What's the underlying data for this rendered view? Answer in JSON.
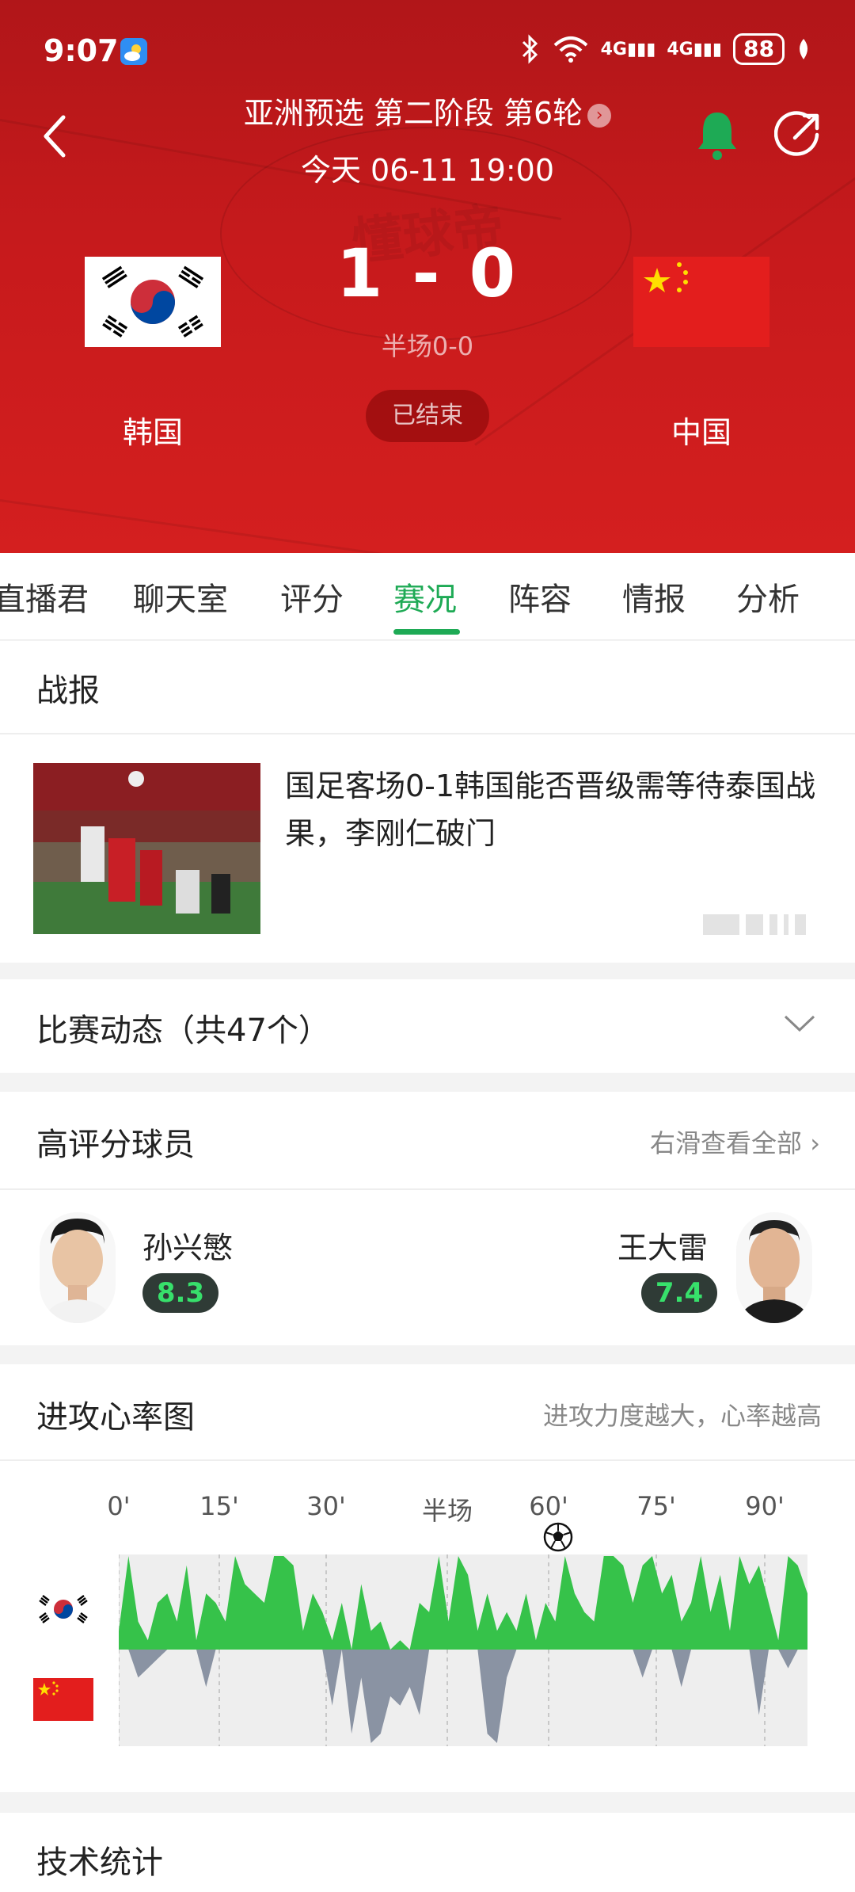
{
  "status_bar": {
    "time": "9:07",
    "network1": "4G",
    "network2": "4G",
    "battery": "88"
  },
  "header": {
    "league": "亚洲预选 第二阶段 第6轮",
    "date": "今天 06-11 19:00",
    "watermark": "懂球帝",
    "home_team": "韩国",
    "away_team": "中国",
    "score": "1 - 0",
    "halftime": "半场0-0",
    "status": "已结束",
    "colors": {
      "header_red": "#c71a1c",
      "bell_green": "#1eaa55"
    }
  },
  "tabs": {
    "items": [
      "直播君",
      "聊天室",
      "评分",
      "赛况",
      "阵容",
      "情报",
      "分析"
    ],
    "active": "赛况",
    "accent": "#1eaa55"
  },
  "report": {
    "title": "战报",
    "news_title": "国足客场0-1韩国能否晋级需等待泰国战果，李刚仁破门"
  },
  "events": {
    "title": "比赛动态（共47个）"
  },
  "top_players": {
    "title": "高评分球员",
    "hint": "右滑查看全部",
    "home": {
      "name": "孙兴慜",
      "rating": "8.3"
    },
    "away": {
      "name": "王大雷",
      "rating": "7.4"
    }
  },
  "heart_chart": {
    "title": "进攻心率图",
    "hint": "进攻力度越大，心率越高",
    "ticks": [
      "0'",
      "15'",
      "30'",
      "半场",
      "60'",
      "75'",
      "90'"
    ],
    "goal_marker": "soccer-ball-icon",
    "colors": {
      "home": "#36c24a",
      "away": "#8a93a3",
      "background": "#eeeeee"
    }
  },
  "chart_data": {
    "type": "area",
    "title": "进攻心率图",
    "x_ticks": [
      "0'",
      "15'",
      "30'",
      "半场",
      "60'",
      "75'",
      "90'"
    ],
    "series": [
      {
        "name": "韩国",
        "values": [
          0.2,
          1.0,
          0.3,
          0.1,
          0.5,
          0.6,
          0.3,
          0.9,
          0.1,
          0.6,
          0.5,
          0.3,
          1.0,
          0.7,
          0.6,
          0.5,
          1.0,
          1.0,
          0.9,
          0.2,
          0.6,
          0.4,
          0.1,
          0.5,
          0.0,
          0.7,
          0.2,
          0.3,
          0.0,
          0.1,
          0.0,
          0.5,
          0.4,
          1.0,
          0.3,
          1.0,
          0.8,
          0.2,
          0.6,
          0.2,
          0.4,
          0.2,
          0.6,
          0.1,
          0.5,
          0.3,
          1.0,
          0.6,
          0.4,
          0.3,
          1.0,
          1.0,
          0.9,
          0.5,
          0.9,
          1.0,
          0.6,
          0.8,
          0.3,
          0.5,
          1.0,
          0.4,
          0.8,
          0.2,
          1.0,
          0.7,
          0.9,
          0.5,
          0.1,
          1.0,
          0.9,
          0.6
        ]
      },
      {
        "name": "中国",
        "values": [
          0.0,
          0.0,
          0.3,
          0.2,
          0.1,
          0.0,
          0.0,
          0.0,
          0.0,
          0.4,
          0.0,
          0.0,
          0.0,
          0.0,
          0.0,
          0.0,
          0.0,
          0.0,
          0.0,
          0.0,
          0.0,
          0.0,
          0.6,
          0.0,
          0.9,
          0.3,
          1.0,
          0.9,
          0.5,
          0.6,
          0.4,
          0.7,
          0.0,
          0.0,
          0.0,
          0.0,
          0.0,
          0.0,
          0.9,
          1.0,
          0.3,
          0.0,
          0.0,
          0.0,
          0.0,
          0.0,
          0.0,
          0.0,
          0.0,
          0.0,
          0.0,
          0.0,
          0.0,
          0.0,
          0.3,
          0.0,
          0.0,
          0.0,
          0.4,
          0.0,
          0.0,
          0.0,
          0.0,
          0.0,
          0.0,
          0.0,
          0.7,
          0.0,
          0.0,
          0.2,
          0.0,
          0.0
        ]
      }
    ]
  },
  "stats": {
    "title": "技术统计"
  }
}
